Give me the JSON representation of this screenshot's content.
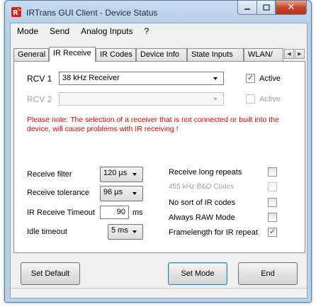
{
  "window": {
    "title": "IRTrans GUI Client - Device Status"
  },
  "menu": [
    "Mode",
    "Send",
    "Analog Inputs",
    "?"
  ],
  "tabs": [
    "General",
    "IR Receive",
    "IR Codes",
    "Device Info",
    "State Inputs",
    "WLAN/"
  ],
  "receivers": {
    "rcv1_label": "RCV 1",
    "rcv1_value": "38 kHz Receiver",
    "rcv1_active_label": "Active",
    "rcv2_label": "RCV 2",
    "rcv2_value": "",
    "rcv2_active_label": "Active"
  },
  "note": "Please note: The selection of a receiver that is not connected or built into the device, will cause problems with IR receiving !",
  "settings": {
    "receive_filter_label": "Receive filter",
    "receive_filter_value": "120 µs",
    "receive_tolerance_label": "Receive tolerance",
    "receive_tolerance_value": "96 µs",
    "ir_timeout_label": "IR Receive Timeout",
    "ir_timeout_value": "90",
    "ir_timeout_unit": "ms",
    "idle_timeout_label": "Idle timeout",
    "idle_timeout_value": "5 ms"
  },
  "options": [
    {
      "label": "Receive long repeats",
      "checked": false,
      "enabled": true
    },
    {
      "label": "455 kHz B&O Codes",
      "checked": false,
      "enabled": false
    },
    {
      "label": "No sort of IR codes",
      "checked": false,
      "enabled": true
    },
    {
      "label": "Always RAW Mode",
      "checked": false,
      "enabled": true
    },
    {
      "label": "Framelength for IR repeat",
      "checked": true,
      "enabled": true
    }
  ],
  "buttons": {
    "set_default": "Set Default",
    "set_mode": "Set Mode",
    "end": "End"
  },
  "colors": {
    "note_text": "#e00000",
    "title_bar": "#b9d0e8",
    "close_button": "#c7452b"
  }
}
